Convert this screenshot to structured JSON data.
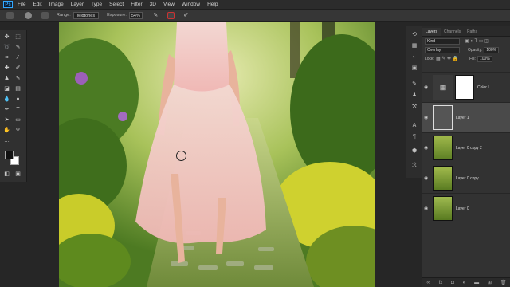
{
  "menubar": {
    "logo": "Ps",
    "items": [
      "File",
      "Edit",
      "Image",
      "Layer",
      "Type",
      "Select",
      "Filter",
      "3D",
      "View",
      "Window",
      "Help"
    ]
  },
  "options": {
    "range_label": "Range:",
    "range_value": "Midtones",
    "exposure_label": "Exposure:",
    "exposure_value": "54%"
  },
  "layers_panel": {
    "tabs": [
      "Layers",
      "Channels",
      "Paths"
    ],
    "filter_kind": "Kind",
    "blend_mode": "Overlay",
    "opacity_label": "Opacity:",
    "opacity_value": "100%",
    "lock_label": "Lock:",
    "fill_label": "Fill:",
    "fill_value": "100%",
    "layers": [
      {
        "name": "Color L..."
      },
      {
        "name": "Layer 1"
      },
      {
        "name": "Layer 0 copy 2"
      },
      {
        "name": "Layer 0 copy"
      },
      {
        "name": "Layer 0"
      }
    ]
  },
  "colors": {
    "accent": "#31a8ff",
    "foreground": "#111111",
    "background": "#ffffff"
  }
}
